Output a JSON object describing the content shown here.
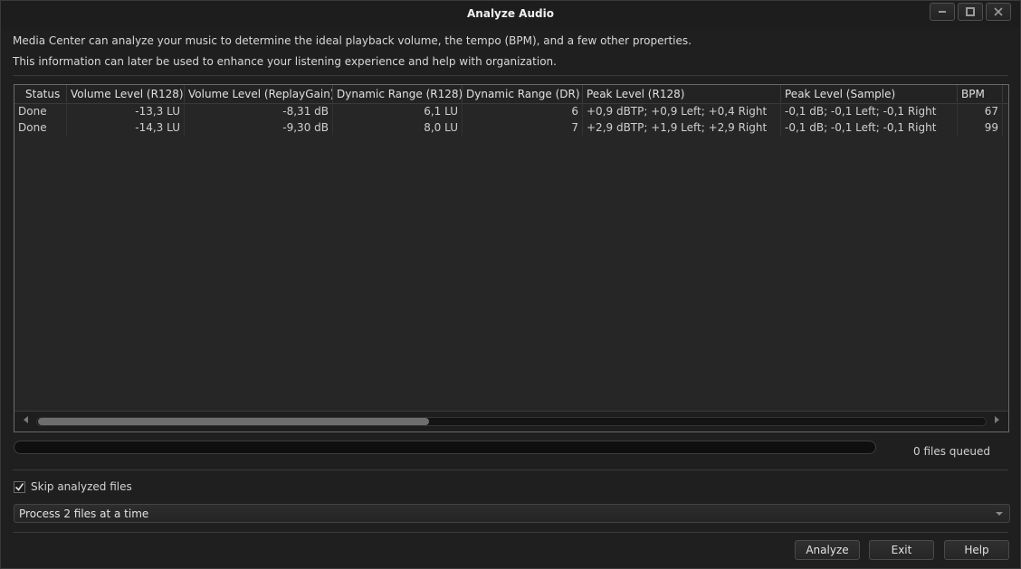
{
  "window": {
    "title": "Analyze Audio",
    "minimize_icon": "minimize-icon",
    "maximize_icon": "maximize-icon",
    "close_icon": "close-icon"
  },
  "description": {
    "line1": "Media Center can analyze your music to determine the ideal playback volume, the tempo (BPM), and a few other properties.",
    "line2": "This information can later be used to enhance your listening experience and help with organization."
  },
  "table": {
    "columns": [
      {
        "key": "status",
        "label": "Status"
      },
      {
        "key": "vol_r128",
        "label": "Volume Level (R128)"
      },
      {
        "key": "vol_rg",
        "label": "Volume Level (ReplayGain)"
      },
      {
        "key": "dr_r128",
        "label": "Dynamic Range (R128)"
      },
      {
        "key": "dr_dr",
        "label": "Dynamic Range (DR)"
      },
      {
        "key": "peak_r128",
        "label": "Peak Level (R128)"
      },
      {
        "key": "peak_sample",
        "label": "Peak Level (Sample)"
      },
      {
        "key": "bpm",
        "label": "BPM"
      }
    ],
    "rows": [
      [
        "Done",
        "-13,3 LU",
        "-8,31 dB",
        "6,1 LU",
        "6",
        "+0,9 dBTP; +0,9 Left; +0,4 Right",
        "-0,1 dB; -0,1 Left; -0,1 Right",
        "67"
      ],
      [
        "Done",
        "-14,3 LU",
        "-9,30 dB",
        "8,0 LU",
        "7",
        "+2,9 dBTP; +1,9 Left; +2,9 Right",
        "-0,1 dB; -0,1 Left; -0,1 Right",
        "99"
      ]
    ]
  },
  "progress": {
    "fraction": 0,
    "queued_text": "0 files queued"
  },
  "options": {
    "skip_label": "Skip analyzed files",
    "skip_checked": true,
    "process_selected": "Process 2 files at a time"
  },
  "buttons": {
    "analyze": "Analyze",
    "exit": "Exit",
    "help": "Help"
  },
  "colors": {
    "background": "#1f1f1f",
    "text": "#d4d4d4",
    "border": "#6a6a6a"
  }
}
